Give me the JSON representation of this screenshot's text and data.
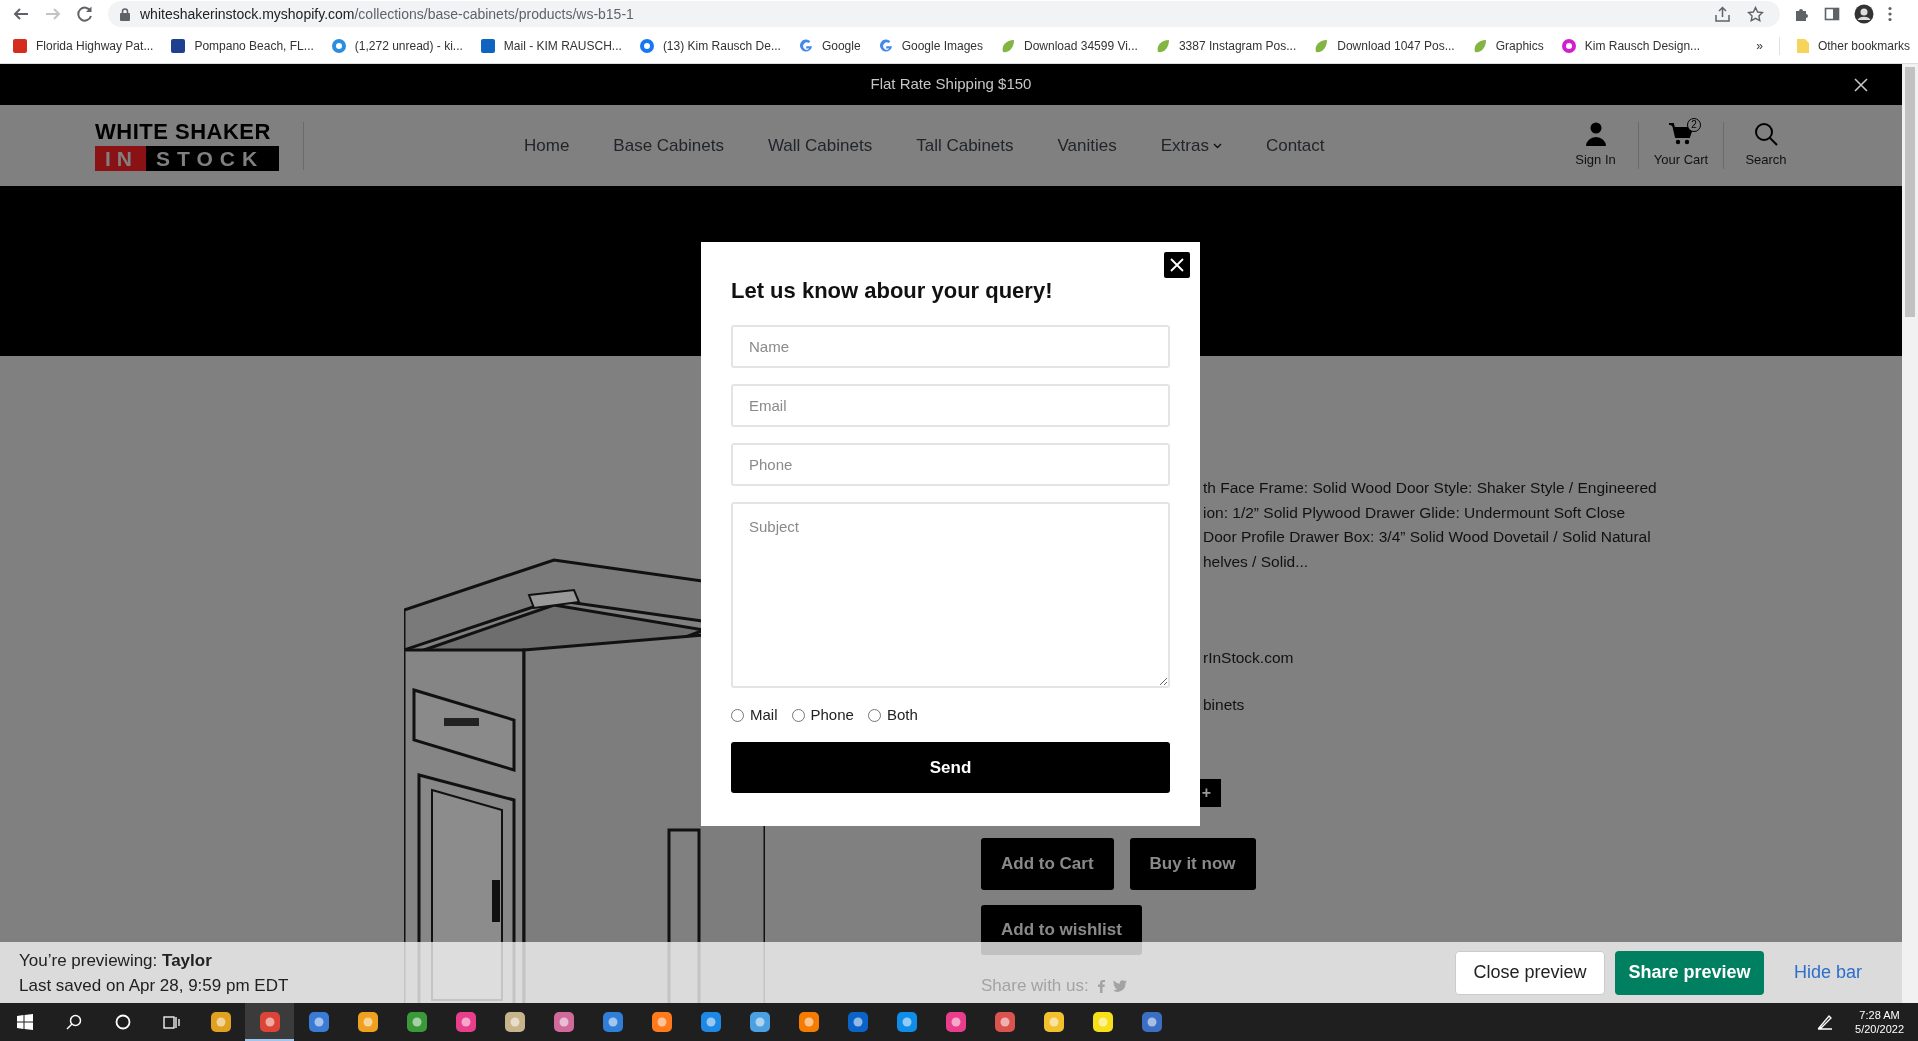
{
  "browser": {
    "url_domain": "whiteshakerinstock.myshopify.com",
    "url_path": "/collections/base-cabinets/products/ws-b15-1",
    "can_go_forward": false,
    "bookmarks": [
      {
        "label": "Florida Highway Pat...",
        "kind": "square",
        "color": "#d62b1f"
      },
      {
        "label": "Pompano Beach, FL...",
        "kind": "square",
        "color": "#1f3f8f"
      },
      {
        "label": "(1,272 unread) - ki...",
        "kind": "circle",
        "color": "#2a8de0"
      },
      {
        "label": "Mail - KIM RAUSCH...",
        "kind": "square",
        "color": "#0f64c0"
      },
      {
        "label": "(13) Kim Rausch De...",
        "kind": "circle",
        "color": "#1877f2"
      },
      {
        "label": "Google",
        "kind": "google",
        "color": "#4285f4"
      },
      {
        "label": "Google Images",
        "kind": "google",
        "color": "#4285f4"
      },
      {
        "label": "Download 34599 Vi...",
        "kind": "leaf",
        "color": "#82b541"
      },
      {
        "label": "3387 Instagram Pos...",
        "kind": "leaf",
        "color": "#82b541"
      },
      {
        "label": "Download 1047 Pos...",
        "kind": "leaf",
        "color": "#82b541"
      },
      {
        "label": "Graphics",
        "kind": "leaf",
        "color": "#82b541"
      },
      {
        "label": "Kim Rausch Design...",
        "kind": "circle",
        "color": "#d01fd0"
      }
    ],
    "overflow": "»",
    "other_bookmarks": "Other bookmarks"
  },
  "announcement": {
    "text": "Flat Rate Shipping $150"
  },
  "header": {
    "logo": {
      "line1": "WHITE SHAKER",
      "line2a": "IN",
      "line2b": "STOCK"
    },
    "nav": [
      {
        "label": "Home",
        "dropdown": false
      },
      {
        "label": "Base Cabinets",
        "dropdown": false
      },
      {
        "label": "Wall Cabinets",
        "dropdown": false
      },
      {
        "label": "Tall Cabinets",
        "dropdown": false
      },
      {
        "label": "Vanities",
        "dropdown": false
      },
      {
        "label": "Extras",
        "dropdown": true
      },
      {
        "label": "Contact",
        "dropdown": false
      }
    ],
    "actions": [
      {
        "kind": "account",
        "label": "Sign In"
      },
      {
        "kind": "cart",
        "label": "Your Cart",
        "count": "2"
      },
      {
        "kind": "search",
        "label": "Search"
      }
    ]
  },
  "product": {
    "description_lines": [
      "th Face Frame: Solid Wood Door Style: Shaker Style / Engineered",
      "ion: 1/2” Solid Plywood Drawer Glide: Undermount Soft Close",
      "Door Profile Drawer Box: 3/4” Solid Wood Dovetail / Solid Natural",
      "helves / Solid..."
    ],
    "vendor_fragment": "rInStock.com",
    "type_fragment": "binets",
    "quantity_plus": "+",
    "buttons": [
      "Add to Cart",
      "Buy it now"
    ],
    "wishlist": "Add to wishlist",
    "share_label": "Share with us:"
  },
  "modal": {
    "title": "Let us know abour your query!",
    "fields": [
      {
        "kind": "input",
        "placeholder": "Name"
      },
      {
        "kind": "input",
        "placeholder": "Email"
      },
      {
        "kind": "input",
        "placeholder": "Phone"
      },
      {
        "kind": "textarea",
        "placeholder": "Subject"
      }
    ],
    "contact_options": [
      {
        "label": "Mail",
        "selected": false
      },
      {
        "label": "Phone",
        "selected": false
      },
      {
        "label": "Both",
        "selected": false
      }
    ],
    "submit": "Send"
  },
  "preview_bar": {
    "previewing": "You’re previewing: **Taylor**",
    "saved": "Last saved on Apr 28, 9:59 pm EDT",
    "close": "Close preview",
    "share": "Share preview",
    "hide": "Hide bar"
  },
  "taskbar": {
    "apps": [
      {
        "color": "#e0a020",
        "active": false
      },
      {
        "color": "#db4437",
        "active": true
      },
      {
        "color": "#3a7bd5",
        "active": false
      },
      {
        "color": "#f0a020",
        "active": false
      },
      {
        "color": "#3a9a3a",
        "active": false
      },
      {
        "color": "#e83e8c",
        "active": false
      },
      {
        "color": "#c8b48a",
        "active": false
      },
      {
        "color": "#d06a9a",
        "active": false
      },
      {
        "color": "#2f7fd8",
        "active": false
      },
      {
        "color": "#ff7a1a",
        "active": false
      },
      {
        "color": "#1e88e5",
        "active": false
      },
      {
        "color": "#4aa0e0",
        "active": false
      },
      {
        "color": "#f57c00",
        "active": false
      },
      {
        "color": "#0a64c8",
        "active": false
      },
      {
        "color": "#0e8ee9",
        "active": false
      },
      {
        "color": "#ea3e8c",
        "active": false
      },
      {
        "color": "#d9534f",
        "active": false
      },
      {
        "color": "#f2c12e",
        "active": false
      },
      {
        "color": "#f7e01a",
        "active": false
      },
      {
        "color": "#3b6fc4",
        "active": false
      }
    ],
    "time": "7:28 AM",
    "date": "5/20/2022"
  }
}
